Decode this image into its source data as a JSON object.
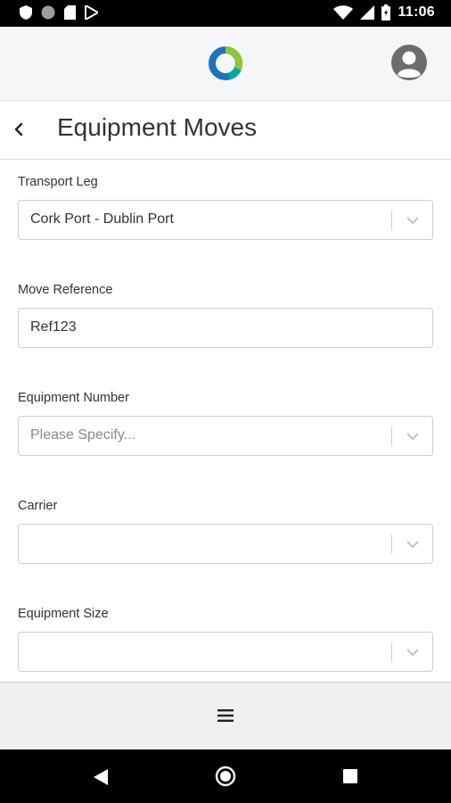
{
  "status_bar": {
    "time": "11:06"
  },
  "page": {
    "title": "Equipment Moves"
  },
  "form": {
    "transport_leg": {
      "label": "Transport Leg",
      "value": "Cork Port - Dublin Port"
    },
    "move_reference": {
      "label": "Move Reference",
      "value": "Ref123"
    },
    "equipment_number": {
      "label": "Equipment Number",
      "placeholder": "Please Specify..."
    },
    "carrier": {
      "label": "Carrier",
      "value": ""
    },
    "equipment_size": {
      "label": "Equipment Size",
      "value": ""
    }
  },
  "icons": {
    "logo": "app-logo-ring",
    "avatar": "user-avatar-icon",
    "back": "chevron-left-icon",
    "menu": "hamburger-menu-icon"
  },
  "colors": {
    "logo_blue": "#1e73be",
    "logo_green": "#8dc63f"
  }
}
